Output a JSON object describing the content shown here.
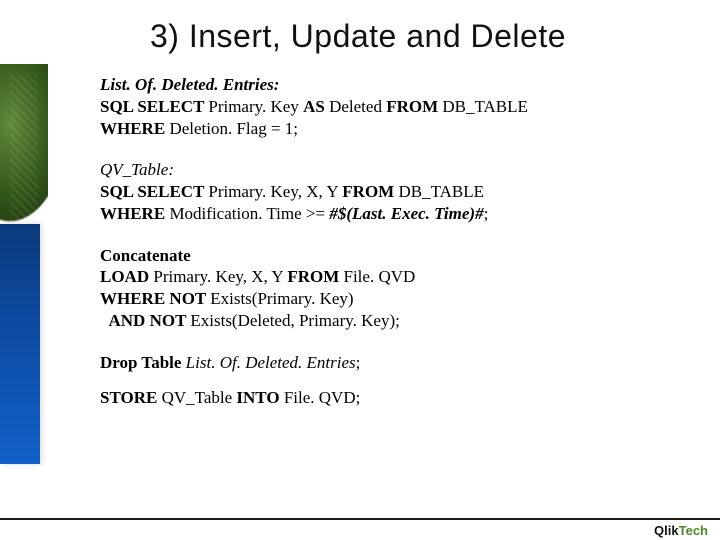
{
  "title": "3) Insert, Update and Delete",
  "block1": {
    "label": "List. Of. Deleted. Entries:",
    "l1a": "SQL SELECT ",
    "l1b": "Primary. Key ",
    "l1c": "AS ",
    "l1d": "Deleted ",
    "l1e": "FROM ",
    "l1f": "DB_TABLE",
    "l2a": "WHERE ",
    "l2b": "Deletion. Flag = 1;"
  },
  "block2": {
    "label": "QV_Table:",
    "l1a": "SQL SELECT ",
    "l1b": "Primary. Key, X, Y ",
    "l1c": "FROM ",
    "l1d": "DB_TABLE",
    "l2a": "WHERE ",
    "l2b": "Modification. Time >= ",
    "l2c": "#$(Last. Exec. Time)#",
    "l2d": ";"
  },
  "block3": {
    "l1": "Concatenate",
    "l2a": "LOAD ",
    "l2b": "Primary. Key, X, Y ",
    "l2c": "FROM ",
    "l2d": "File. QVD",
    "l3a": "WHERE NOT ",
    "l3b": "Exists(Primary. Key)",
    "l4a": "  AND NOT ",
    "l4b": "Exists(Deleted, Primary. Key);"
  },
  "block4": {
    "a": "Drop Table ",
    "b": "List. Of. Deleted. Entries",
    "c": ";"
  },
  "block5": {
    "a": "STORE ",
    "b": "QV_Table ",
    "c": "INTO ",
    "d": "File. QVD;"
  },
  "logo": {
    "q": "Qlik",
    "t": "Tech"
  }
}
